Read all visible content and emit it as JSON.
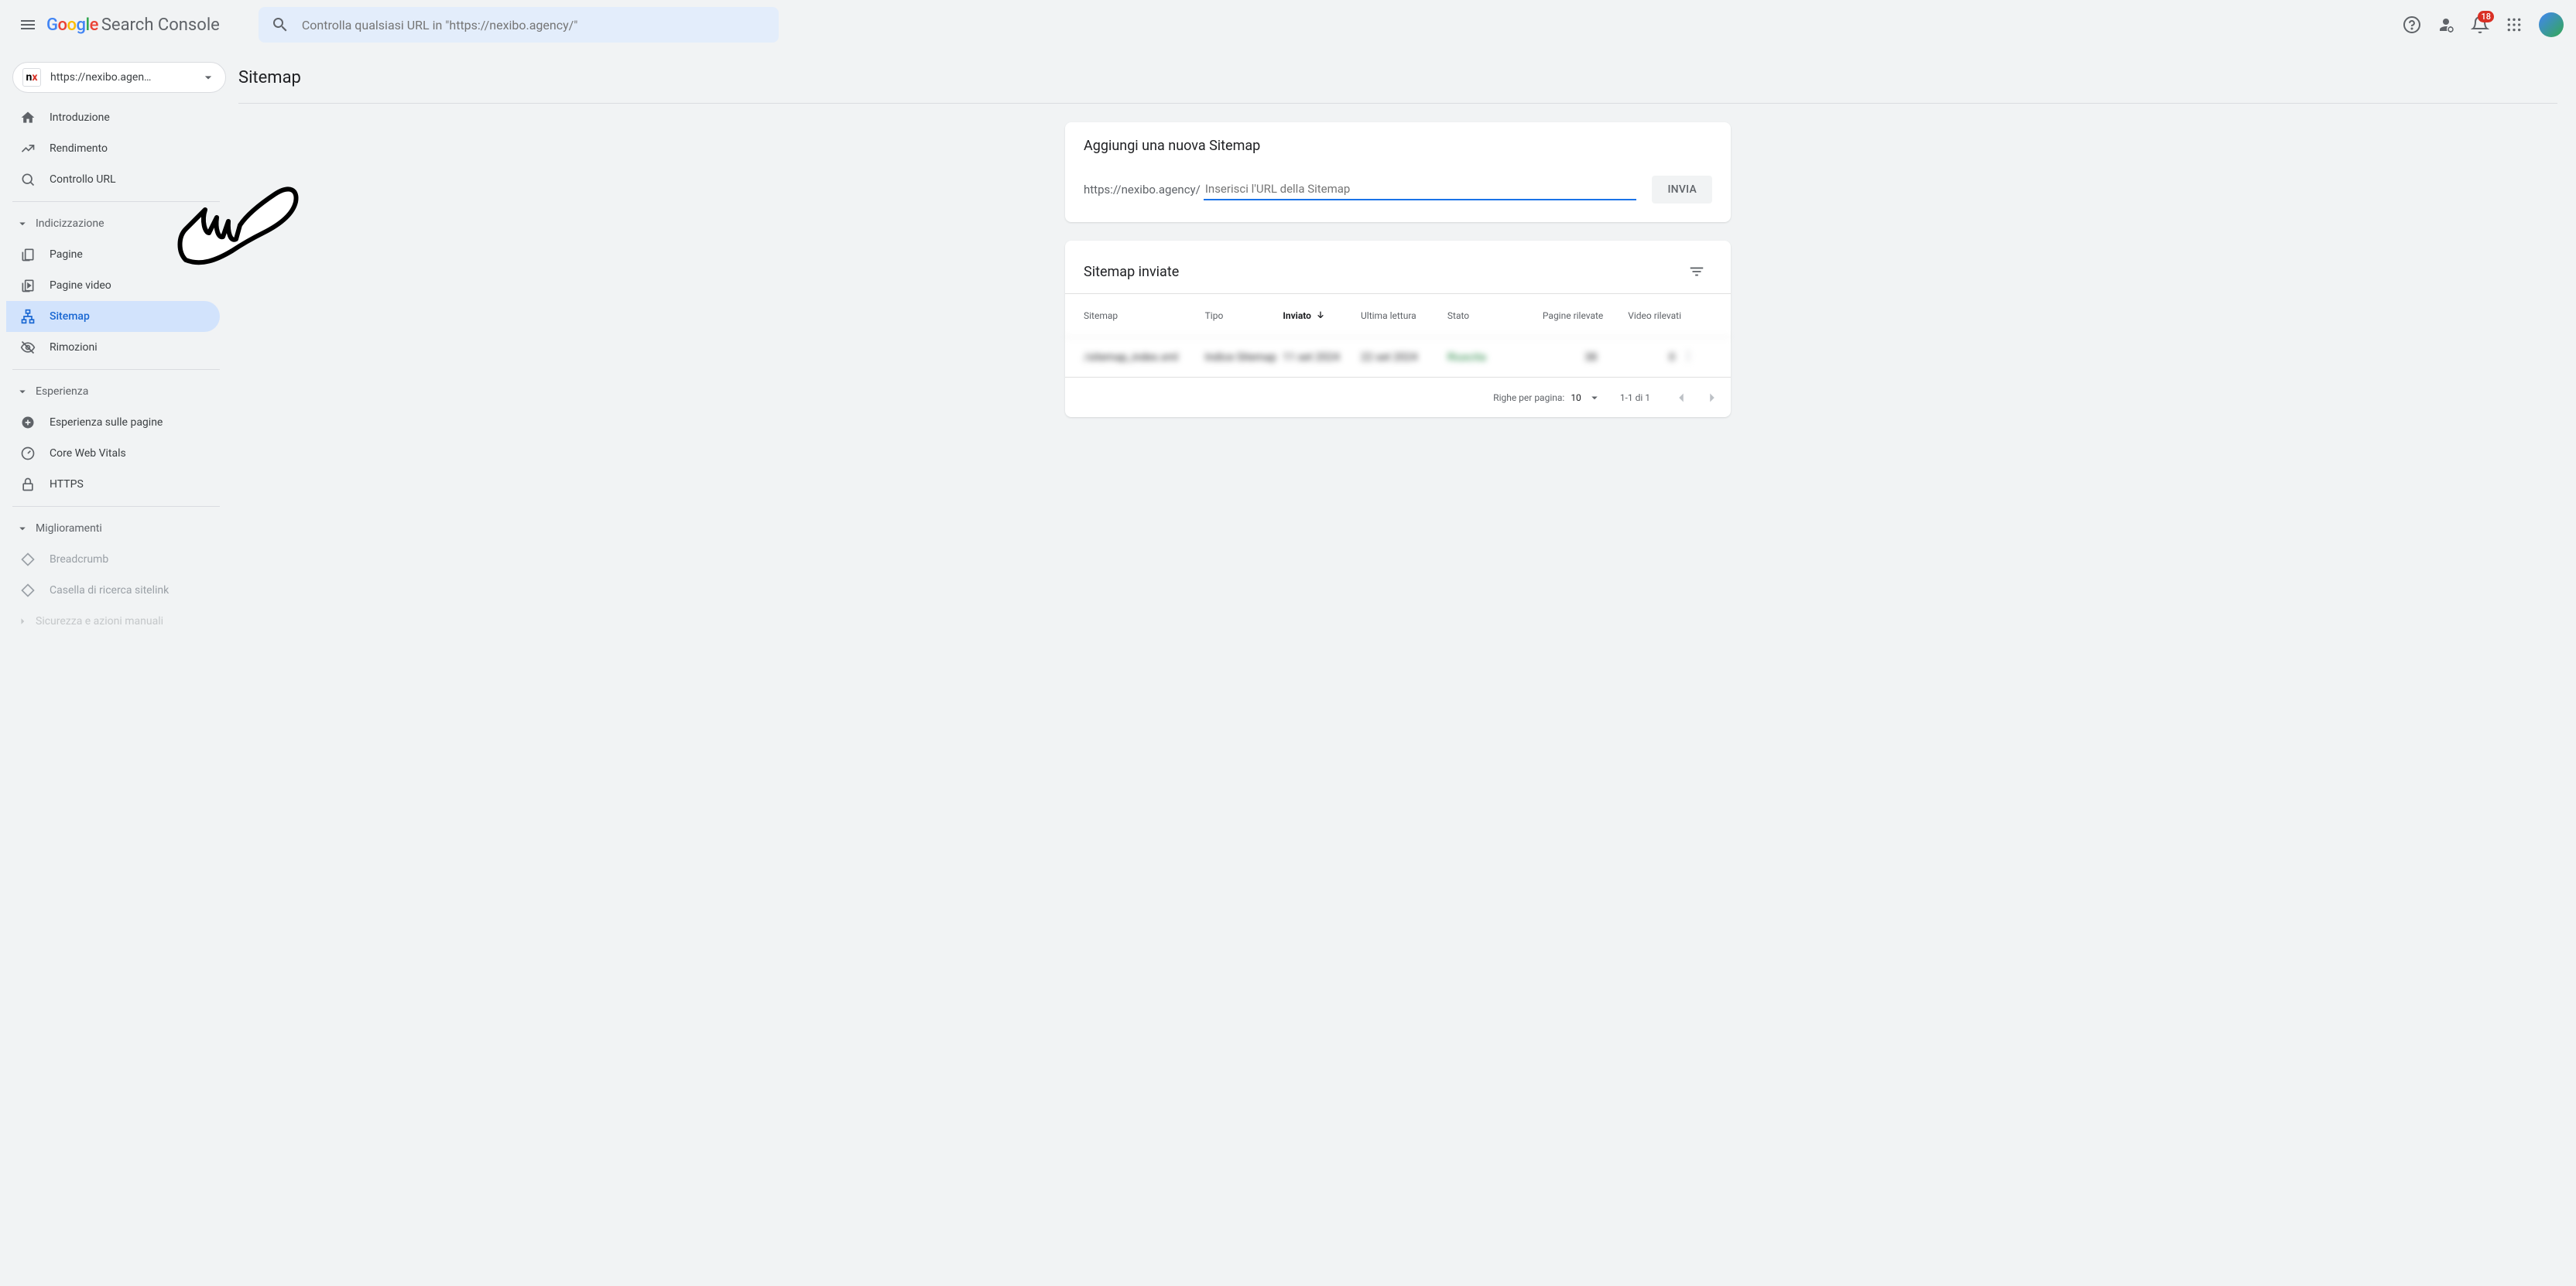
{
  "header": {
    "product_name": "Search Console",
    "search_placeholder": "Controlla qualsiasi URL in \"https://nexibo.agency/\"",
    "notification_count": "18"
  },
  "property": {
    "label": "https://nexibo.agen…"
  },
  "sidebar": {
    "top": [
      {
        "label": "Introduzione"
      },
      {
        "label": "Rendimento"
      },
      {
        "label": "Controllo URL"
      }
    ],
    "sections": [
      {
        "title": "Indicizzazione",
        "items": [
          {
            "label": "Pagine"
          },
          {
            "label": "Pagine video"
          },
          {
            "label": "Sitemap",
            "selected": true
          },
          {
            "label": "Rimozioni"
          }
        ]
      },
      {
        "title": "Esperienza",
        "items": [
          {
            "label": "Esperienza sulle pagine"
          },
          {
            "label": "Core Web Vitals"
          },
          {
            "label": "HTTPS"
          }
        ]
      },
      {
        "title": "Miglioramenti",
        "items": [
          {
            "label": "Breadcrumb",
            "muted": true
          },
          {
            "label": "Casella di ricerca sitelink",
            "muted": true
          }
        ]
      },
      {
        "title": "Sicurezza e azioni manuali",
        "muted": true,
        "items": []
      }
    ]
  },
  "page": {
    "title": "Sitemap"
  },
  "add_card": {
    "title": "Aggiungi una nuova Sitemap",
    "prefix": "https://nexibo.agency/",
    "placeholder": "Inserisci l'URL della Sitemap",
    "submit": "INVIA"
  },
  "list_card": {
    "title": "Sitemap inviate",
    "columns": {
      "sitemap": "Sitemap",
      "type": "Tipo",
      "sent": "Inviato",
      "last_read": "Ultima lettura",
      "status": "Stato",
      "pages": "Pagine rilevate",
      "videos": "Video rilevati"
    },
    "rows": [
      {
        "sitemap": "/sitemap_index.xml",
        "type": "Indice Sitemap",
        "sent": "11 set 2024",
        "last_read": "22 set 2024",
        "status": "Riuscita",
        "pages": "38",
        "videos": "0"
      }
    ],
    "footer": {
      "rpp_label": "Righe per pagina:",
      "rpp_value": "10",
      "range": "1-1 di 1"
    }
  }
}
